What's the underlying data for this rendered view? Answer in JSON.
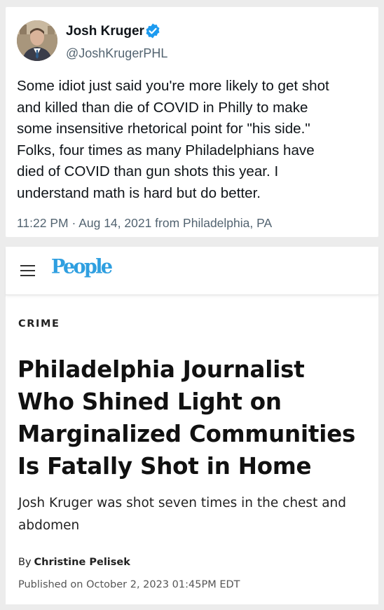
{
  "tweet": {
    "author_name": "Josh Kruger",
    "handle": "@JoshKrugerPHL",
    "verified_icon": "verified-badge-icon",
    "text_lines": [
      "Some idiot just said you're more likely to get shot",
      "and killed than die of COVID in Philly to make",
      "some insensitive rhetorical point for \"his side.\"",
      "Folks, four times as many Philadelphians have",
      "died of COVID than gun shots this year. I",
      "understand math is hard but do better."
    ],
    "timestamp": "11:22 PM · Aug 14, 2021 from Philadelphia, PA",
    "colors": {
      "verified": "#1d9bf0",
      "muted": "#536471"
    }
  },
  "article": {
    "menu_icon": "hamburger-menu-icon",
    "brand": "People",
    "category": "CRIME",
    "headline_lines": [
      "Philadelphia Journalist",
      "Who Shined Light on",
      "Marginalized Communities",
      "Is Fatally Shot in Home"
    ],
    "dek_lines": [
      "Josh Kruger was shot seven times in the chest and",
      "abdomen"
    ],
    "byline_prefix": "By",
    "author": "Christine Pelisek",
    "published": "Published on October 2, 2023 01:45PM EDT",
    "colors": {
      "brand": "#2f9fe0"
    }
  }
}
